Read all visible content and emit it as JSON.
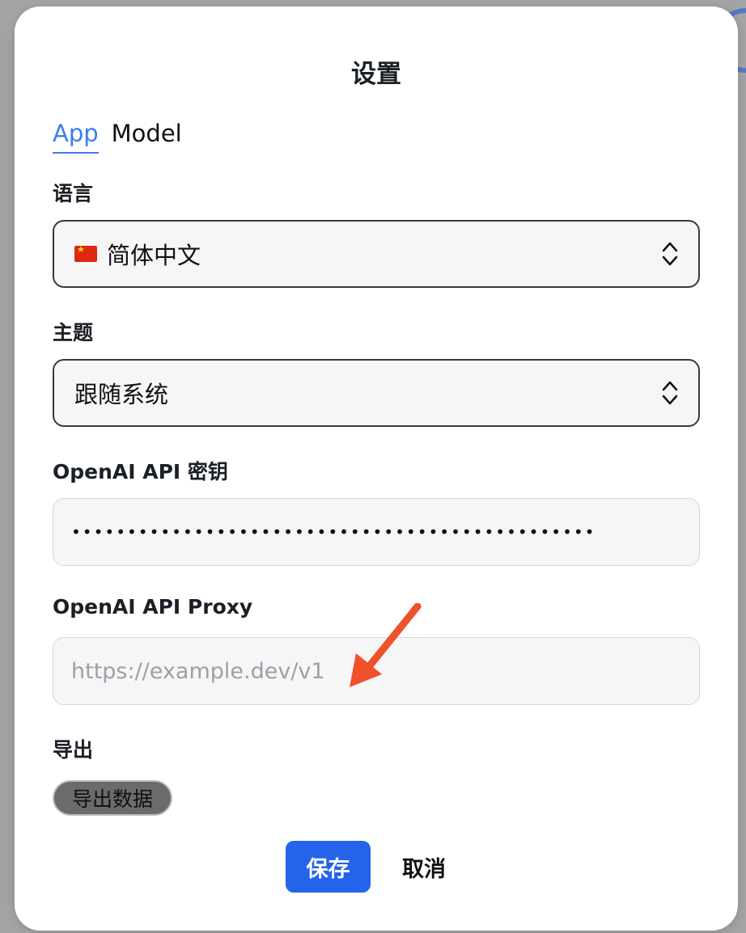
{
  "dialog": {
    "title": "设置"
  },
  "tabs": [
    {
      "label": "App",
      "active": true
    },
    {
      "label": "Model",
      "active": false
    }
  ],
  "language": {
    "label": "语言",
    "value": "简体中文",
    "flag_icon": "china-flag-icon"
  },
  "theme": {
    "label": "主题",
    "value": "跟随系统"
  },
  "api_key": {
    "label": "OpenAI API 密钥",
    "value_masked": "•••••••••••••••••••••••••••••••••••••••••••••••"
  },
  "api_proxy": {
    "label": "OpenAI API Proxy",
    "placeholder": "https://example.dev/v1",
    "value": ""
  },
  "export": {
    "label": "导出",
    "button_label": "导出数据"
  },
  "footer": {
    "save_label": "保存",
    "cancel_label": "取消"
  },
  "colors": {
    "accent": "#3a7df0",
    "primary_button": "#2563eb",
    "annotation_arrow": "#f0502a"
  }
}
